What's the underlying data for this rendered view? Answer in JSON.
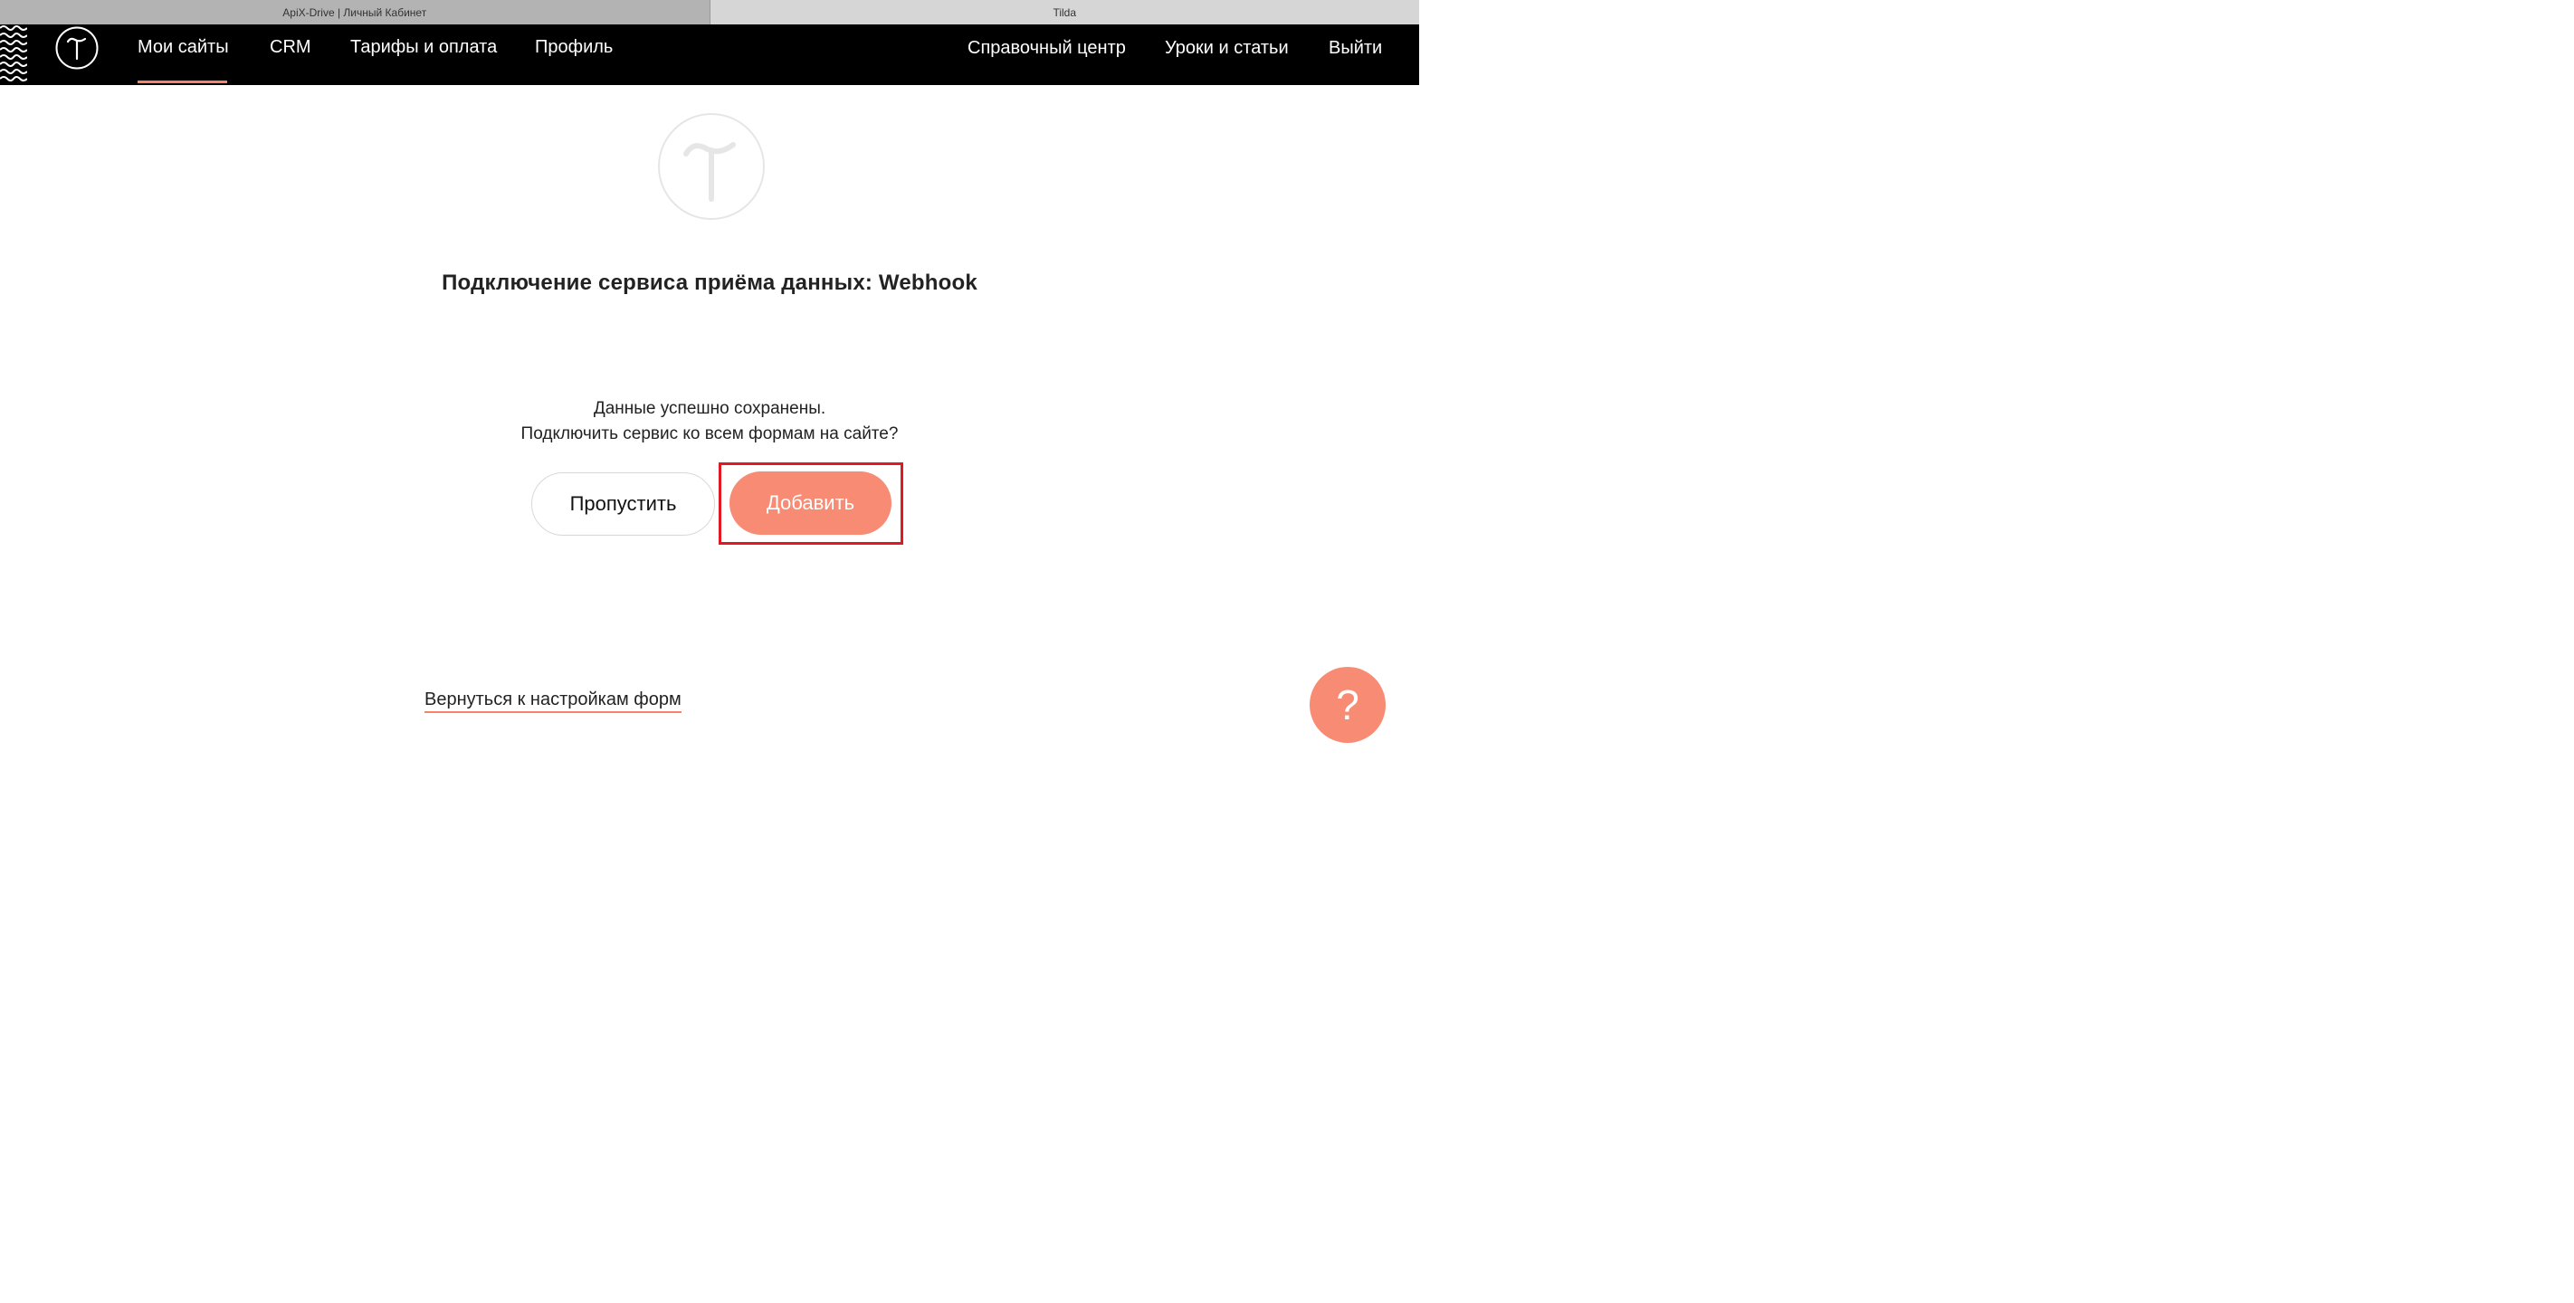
{
  "browser": {
    "tabs": [
      {
        "title": "ApiX-Drive | Личный Кабинет"
      },
      {
        "title": "Tilda"
      }
    ]
  },
  "nav": {
    "left": [
      {
        "label": "Мои сайты"
      },
      {
        "label": "CRM"
      },
      {
        "label": "Тарифы и оплата"
      },
      {
        "label": "Профиль"
      }
    ],
    "right": [
      {
        "label": "Справочный центр"
      },
      {
        "label": "Уроки и статьи"
      },
      {
        "label": "Выйти"
      }
    ],
    "active_index": 0
  },
  "main": {
    "title": "Подключение сервиса приёма данных: Webhook",
    "message_line1": "Данные успешно сохранены.",
    "message_line2": "Подключить сервис ко всем формам на сайте?",
    "skip_label": "Пропустить",
    "add_label": "Добавить",
    "back_link": "Вернуться к настройкам форм"
  },
  "help": {
    "label": "?"
  },
  "colors": {
    "accent": "#f88b73",
    "navbar": "#000000",
    "highlight": "#e01a22"
  },
  "icons": {
    "logo": "tilda-logo-icon",
    "help": "question-icon"
  }
}
